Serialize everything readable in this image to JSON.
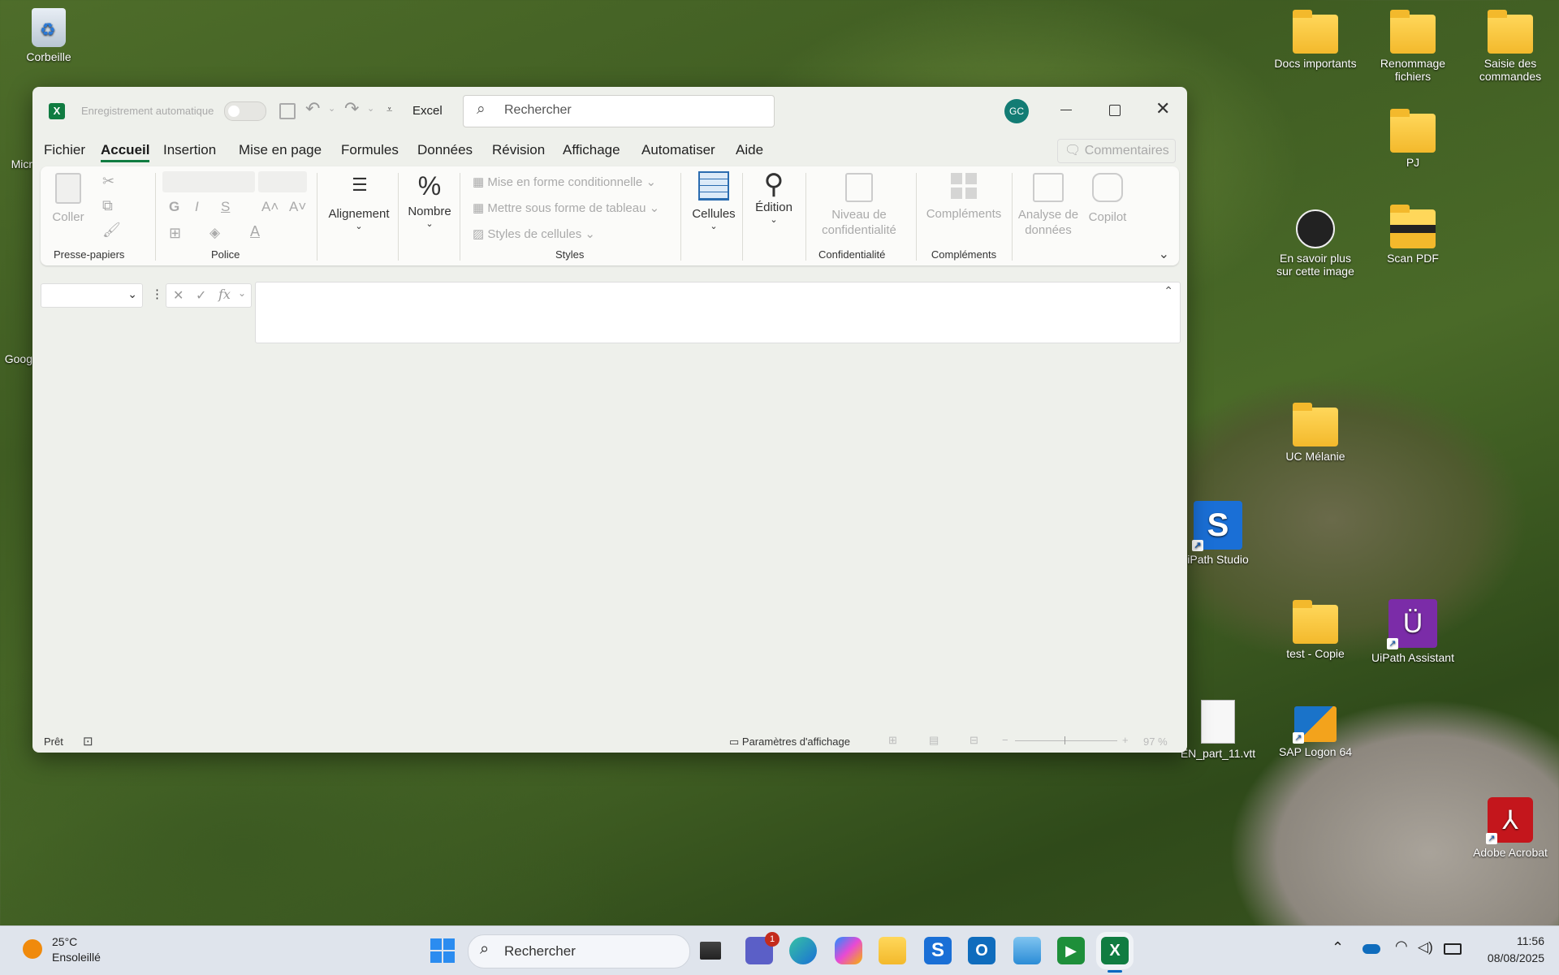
{
  "desktop_icons": {
    "recycle": "Corbeille",
    "docs": "Docs importants",
    "rename": "Renommage fichiers",
    "orders": "Saisie des commandes",
    "pj": "PJ",
    "learn": "En savoir plus sur cette image",
    "scan": "Scan PDF",
    "uc": "UC Mélanie",
    "uipath_studio": "iPath Studio",
    "test": "test - Copie",
    "uipath_assistant": "UiPath Assistant",
    "vtt": "EN_part_11.vtt",
    "sap": "SAP Logon 64",
    "acrobat": "Adobe Acrobat",
    "left1": "Micr",
    "left2": "Goog"
  },
  "excel": {
    "autosave": "Enregistrement automatique",
    "app": "Excel",
    "search_placeholder": "Rechercher",
    "avatar": "GC",
    "comments": "Commentaires",
    "tabs": [
      "Fichier",
      "Accueil",
      "Insertion",
      "Mise en page",
      "Formules",
      "Données",
      "Révision",
      "Affichage",
      "Automatiser",
      "Aide"
    ],
    "ribbon": {
      "paste": "Coller",
      "clipboard": "Presse-papiers",
      "bold": "G",
      "italic": "I",
      "underline": "S",
      "font": "Police",
      "alignment": "Alignement",
      "number": "Nombre",
      "cond_format": "Mise en forme conditionnelle",
      "table_format": "Mettre sous forme de tableau",
      "cell_styles": "Styles de cellules",
      "styles": "Styles",
      "cells": "Cellules",
      "editing": "Édition",
      "sensitivity": "Niveau de confidentialité",
      "confidentiality": "Confidentialité",
      "addins_btn": "Compléments",
      "addins_group": "Compléments",
      "analyze": "Analyse de données",
      "copilot": "Copilot"
    },
    "status": {
      "ready": "Prêt",
      "display_settings": "Paramètres d'affichage",
      "zoom": "97 %"
    }
  },
  "taskbar": {
    "temp": "25°C",
    "weather": "Ensoleillé",
    "search": "Rechercher",
    "teams_badge": "1",
    "time": "11:56",
    "date": "08/08/2025"
  }
}
